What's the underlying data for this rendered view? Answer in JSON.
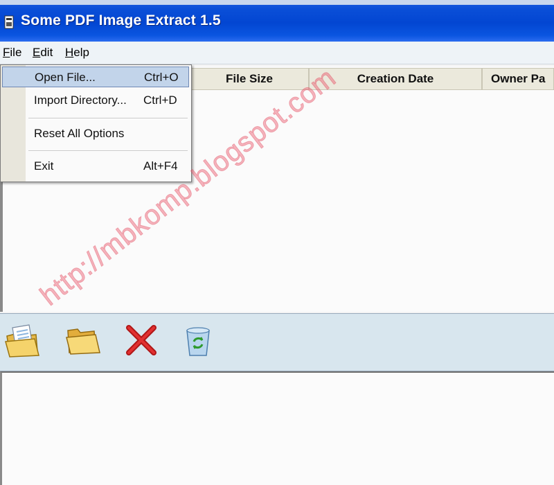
{
  "window": {
    "title": "Some PDF Image Extract 1.5"
  },
  "menubar": {
    "file": {
      "underline": "F",
      "rest": "ile"
    },
    "edit": {
      "underline": "E",
      "rest": "dit"
    },
    "help": {
      "underline": "H",
      "rest": "elp"
    }
  },
  "columns": [
    "File Size",
    "Creation Date",
    "Owner Pa"
  ],
  "file_menu": {
    "items": [
      {
        "label": "Open File...",
        "shortcut": "Ctrl+O"
      },
      {
        "label": "Import Directory...",
        "shortcut": "Ctrl+D"
      },
      {
        "label": "Reset All Options",
        "shortcut": ""
      },
      {
        "label": "Exit",
        "shortcut": "Alt+F4"
      }
    ]
  },
  "toolbar": {
    "icons": [
      "open-file-icon",
      "open-folder-icon",
      "delete-icon",
      "recycle-bin-icon"
    ]
  },
  "watermark": "http://mbkomp.blogspot.com"
}
